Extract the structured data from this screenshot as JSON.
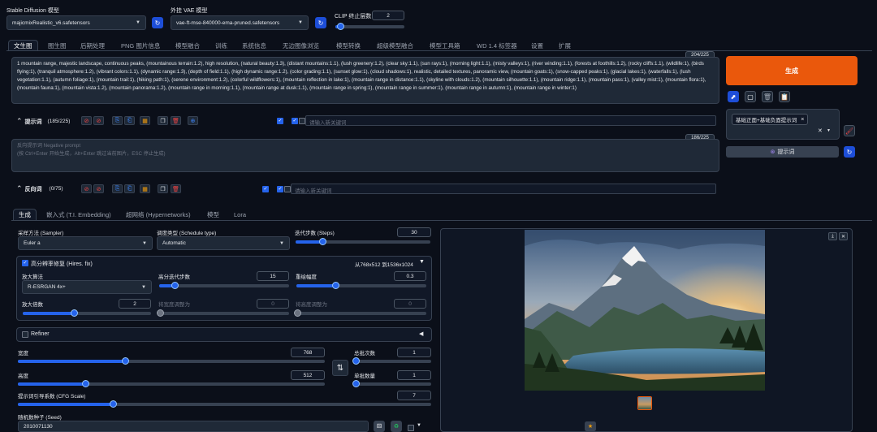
{
  "header": {
    "sd_model_label": "Stable Diffusion 模型",
    "sd_model_value": "majicmixRealistic_v6.safetensors",
    "vae_label": "外挂 VAE 模型",
    "vae_value": "vae-ft-mse-840000-ema-pruned.safetensors",
    "clip_label": "CLIP 终止层数",
    "clip_value": "2",
    "clip_fraction": 0.08
  },
  "main_tabs": [
    "文生图",
    "图生图",
    "后期处理",
    "PNG 图片信息",
    "模型融合",
    "训练",
    "系统信息",
    "无边图像浏览",
    "模型转换",
    "超级模型融合",
    "模型工具箱",
    "WD 1.4 标签器",
    "设置",
    "扩展"
  ],
  "prompt": {
    "counter": "204/225",
    "text": "1 mountain range, majestic landscape, continuous peaks, (mountainous terrain:1.2), high resolution, (natural beauty:1.3), (distant mountains:1.1), (lush greenery:1.2), (clear sky:1.1), (sun rays:1), (morning light:1.1), (misty valleys:1), (river winding:1.1), (forests at foothills:1.2), (rocky cliffs:1.1), (wildlife:1), (birds flying:1), (tranquil atmosphere:1.2), (vibrant colors:1.1), (dynamic range:1.3), (depth of field:1.1), (high dynamic range:1.2), (color grading:1.1), (sunset glow:1), (cloud shadows:1), realistic, detailed textures, panoramic view, (mountain goats:1), (snow-capped peaks:1), (glacial lakes:1), (waterfalls:1), (lush vegetation:1.1), (autumn foliage:1), (mountain trail:1), (hiking path:1), (serene environment:1.2), (colorful wildflowers:1), (mountain reflection in lake:1), (mountain range in distance:1.1), (skyline with clouds:1.2), (mountain silhouette:1.1), (mountain ridge:1.1), (mountain pass:1), (valley mist:1), (mountain flora:1), (mountain fauna:1), (mountain vista:1.2), (mountain panorama:1.2), (mountain range in morning:1.1), (mountain range at dusk:1.1), (mountain range in spring:1), (mountain range in summer:1), (mountain range in autumn:1), (mountain range in winter:1)",
    "toolbar_label": "提示词",
    "toolbar_count": "(185/225)",
    "keyword_placeholder": "请输入新关键词"
  },
  "negative": {
    "counter": "186/225",
    "placeholder_line1": "反向提示词 Negative prompt",
    "placeholder_line2": "(按 Ctrl+Enter 开始生成，Alt+Enter 跳过当前图片，ESC 停止生成)",
    "toolbar_label": "反向词",
    "toolbar_count": "(0/75)",
    "keyword_placeholder": "请输入新关键词"
  },
  "right": {
    "generate_label": "生成",
    "style_tag": "基础正面+基础负面提示词",
    "style_tag_close": "×",
    "prompt_btn": "提示词"
  },
  "sub_tabs": [
    "生成",
    "嵌入式 (T.I. Embedding)",
    "超网络 (Hypernetworks)",
    "模型",
    "Lora"
  ],
  "params": {
    "sampler_label": "采样方法 (Sampler)",
    "sampler_value": "Euler a",
    "schedule_label": "调度类型 (Schedule type)",
    "schedule_value": "Automatic",
    "steps_label": "迭代步数 (Steps)",
    "steps_value": "30",
    "steps_fraction": 0.2,
    "hires_label": "高分辨率修复 (Hires. fix)",
    "hires_info": "从768x512 到1536x1024",
    "upscaler_label": "放大算法",
    "upscaler_value": "R-ESRGAN 4x+",
    "hires_steps_label": "高分迭代步数",
    "hires_steps_value": "15",
    "hires_steps_fraction": 0.12,
    "denoise_label": "重绘幅度",
    "denoise_value": "0.3",
    "denoise_fraction": 0.3,
    "upscale_by_label": "放大倍数",
    "upscale_by_value": "2",
    "upscale_by_fraction": 0.4,
    "resize_w_label": "将宽度调整为",
    "resize_w_value": "0",
    "resize_h_label": "将高度调整为",
    "resize_h_value": "0",
    "refiner_label": "Refiner",
    "width_label": "宽度",
    "width_value": "768",
    "width_fraction": 0.35,
    "height_label": "高度",
    "height_value": "512",
    "height_fraction": 0.22,
    "batch_count_label": "总批次数",
    "batch_count_value": "1",
    "batch_size_label": "单批数量",
    "batch_size_value": "1",
    "cfg_label": "提示词引导系数 (CFG Scale)",
    "cfg_value": "7",
    "cfg_fraction": 0.23,
    "seed_label": "随机数种子 (Seed)",
    "seed_value": "2010071130"
  },
  "icons": {
    "swap": "⇅",
    "refresh": "↻",
    "dice": "🎲",
    "recycle": "♻"
  }
}
